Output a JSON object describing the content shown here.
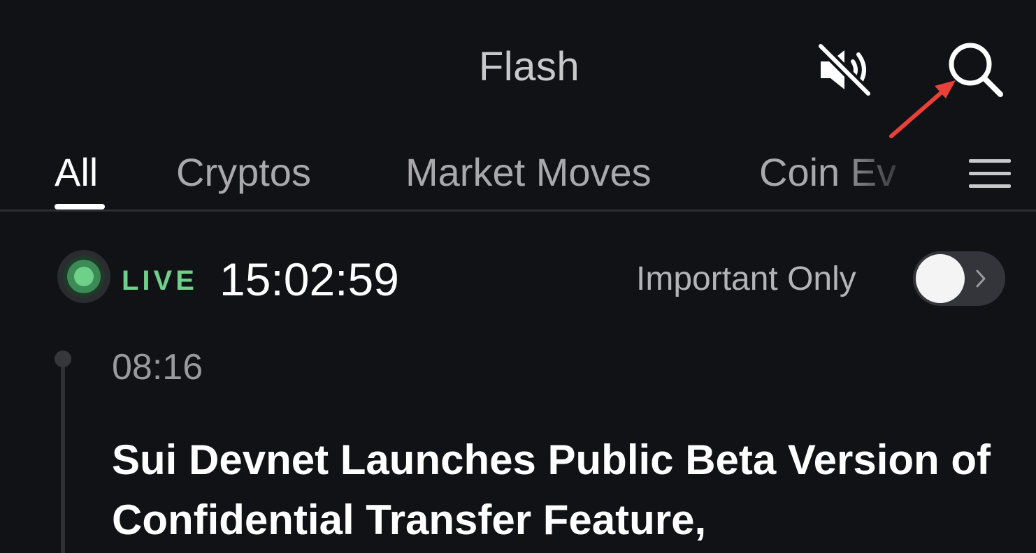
{
  "header": {
    "title": "Flash"
  },
  "tabs": [
    {
      "label": "All",
      "active": true
    },
    {
      "label": "Cryptos",
      "active": false
    },
    {
      "label": "Market Moves",
      "active": false
    },
    {
      "label": "Coin Ev",
      "active": false
    }
  ],
  "icons": {
    "mute": "speaker-muted-icon",
    "search": "search-icon",
    "menu": "hamburger-menu-icon"
  },
  "live": {
    "label": "LIVE",
    "time": "15:02:59",
    "important_label": "Important Only",
    "important_only_enabled": false
  },
  "feed": [
    {
      "time": "08:16",
      "headline": "Sui Devnet Launches Public Beta Version of Confidential Transfer Feature,"
    }
  ],
  "colors": {
    "background": "#111216",
    "live_green": "#6fd08a",
    "annotation_red": "#e8413a"
  }
}
